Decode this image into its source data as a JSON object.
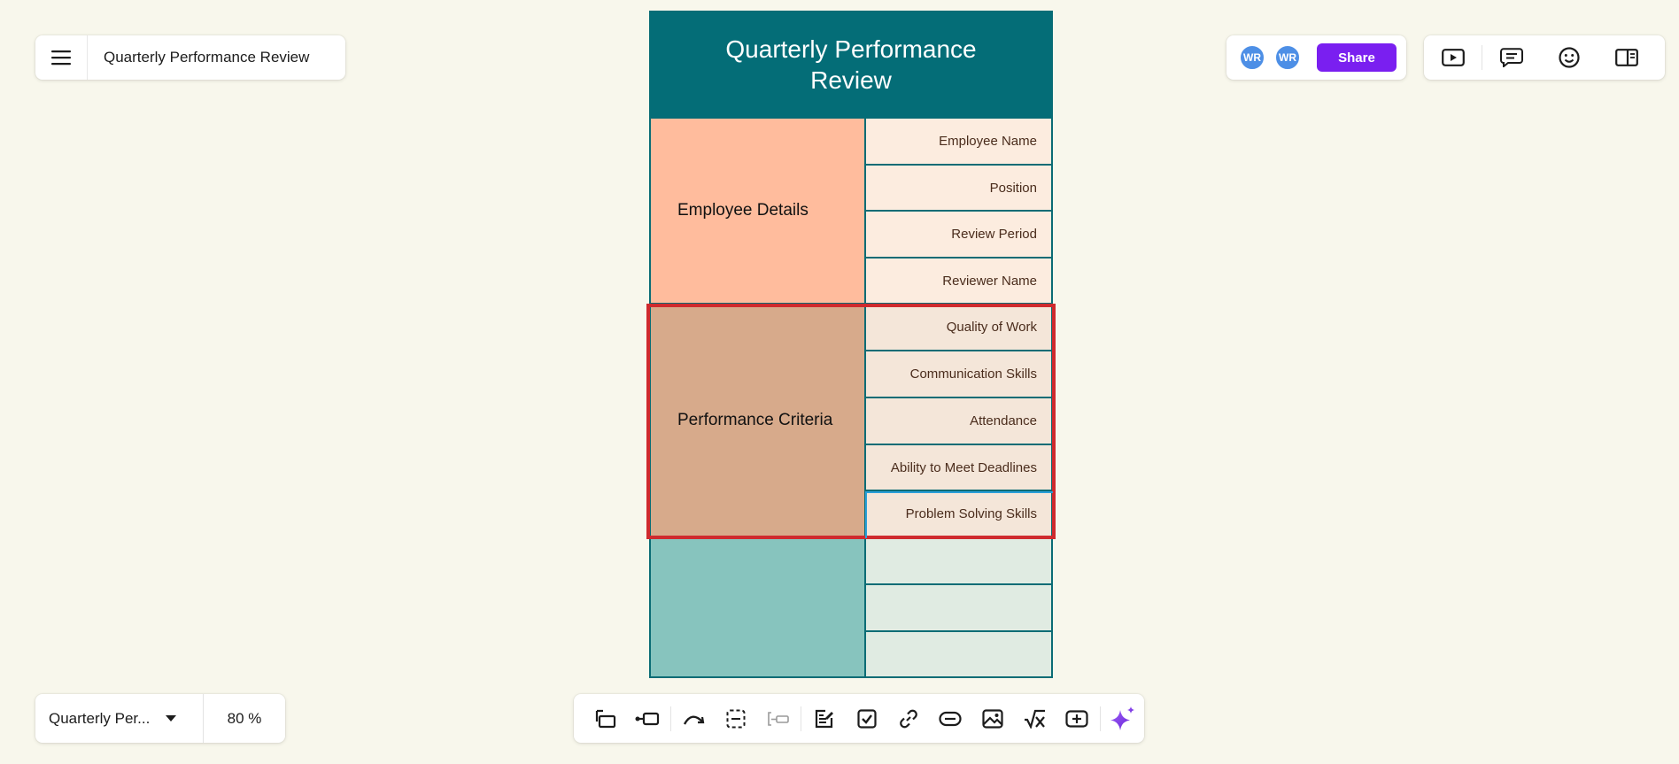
{
  "header": {
    "board_title": "Quarterly Performance Review",
    "menu_icon": "hamburger-menu-icon"
  },
  "collaborators": {
    "avatars": [
      "WR",
      "WR"
    ],
    "avatar_color": "#4d8fe6",
    "share_label": "Share",
    "share_color": "#7a1ff0"
  },
  "top_tools": [
    "present-icon",
    "comments-icon",
    "reactions-icon",
    "side-panel-icon"
  ],
  "footer": {
    "board_name": "Quarterly Per...",
    "zoom": "80 %"
  },
  "bottom_tools": [
    "frame-icon",
    "connector-icon",
    "curve-arrow-icon",
    "select-area-icon",
    "text-box-icon",
    "note-icon",
    "checkbox-icon",
    "link-icon",
    "embed-icon",
    "image-icon",
    "formula-icon",
    "add-shape-icon",
    "ai-sparkle-icon"
  ],
  "table": {
    "title": "Quarterly Performance Review",
    "title_color": "#046d77",
    "sections": [
      {
        "label": "Employee Details",
        "color": "#ffbc9d",
        "cell_color": "#fcecdf",
        "rows": [
          "Employee Name",
          "Position",
          "Review Period",
          "Reviewer Name"
        ]
      },
      {
        "label": "Performance Criteria",
        "color": "#d7aa8b",
        "cell_color": "#f4e6d9",
        "rows": [
          "Quality of Work",
          "Communication Skills",
          "Attendance",
          "Ability to Meet Deadlines",
          "Problem Solving Skills"
        ]
      },
      {
        "label": "",
        "color": "#87c4be",
        "cell_color": "#e0ebe2",
        "rows": [
          "",
          "",
          ""
        ]
      }
    ],
    "selection_color": "#cf2a2e",
    "active_cell_color": "#2a9fd8"
  }
}
